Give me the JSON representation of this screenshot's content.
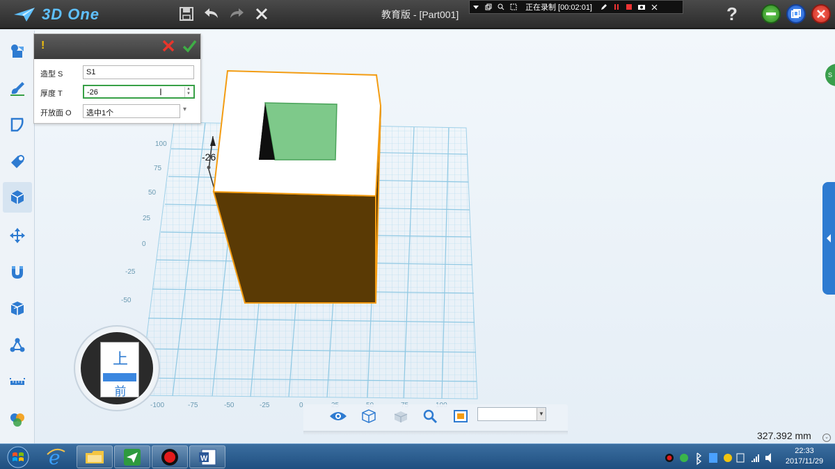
{
  "app": {
    "brand": "3D One",
    "window_title": "教育版 - [Part001]",
    "help": "?"
  },
  "recording": {
    "status": "正在录制 [00:02:01]"
  },
  "left_tools": [
    {
      "name": "basic-shapes-tool-icon"
    },
    {
      "name": "sketch-tool-icon"
    },
    {
      "name": "sketch-edit-tool-icon"
    },
    {
      "name": "combine-tool-icon"
    },
    {
      "name": "special-feature-tool-icon",
      "active": true
    },
    {
      "name": "move-tool-icon"
    },
    {
      "name": "magnet-tool-icon"
    },
    {
      "name": "group-tool-icon"
    },
    {
      "name": "array-tool-icon"
    },
    {
      "name": "measure-tool-icon"
    },
    {
      "name": "color-tool-icon"
    }
  ],
  "panel": {
    "warning": "!",
    "rows": [
      {
        "label": "造型 S",
        "value": "S1"
      },
      {
        "label": "厚度 T",
        "value": "-26"
      },
      {
        "label": "开放面 O",
        "value": "选中1个"
      }
    ]
  },
  "viewport": {
    "dimension_label": "-26",
    "y_ticks": [
      "100",
      "75",
      "50",
      "25",
      "0",
      "-25",
      "-50"
    ],
    "x_ticks": [
      "-100",
      "-75",
      "-50",
      "-25",
      "0",
      "25",
      "50",
      "75",
      "100"
    ],
    "view_cube": {
      "top_label": "上",
      "front_label": "前"
    }
  },
  "status": {
    "measure": "327.392 mm"
  },
  "taskbar": {
    "time": "22:33",
    "date": "2017/11/29"
  },
  "colors": {
    "box_side": "#5a3a05",
    "box_edge": "#f39c12",
    "opening_face": "#7ec98a",
    "grid": "#9fd0e8",
    "accent_blue": "#2e7bd1"
  }
}
